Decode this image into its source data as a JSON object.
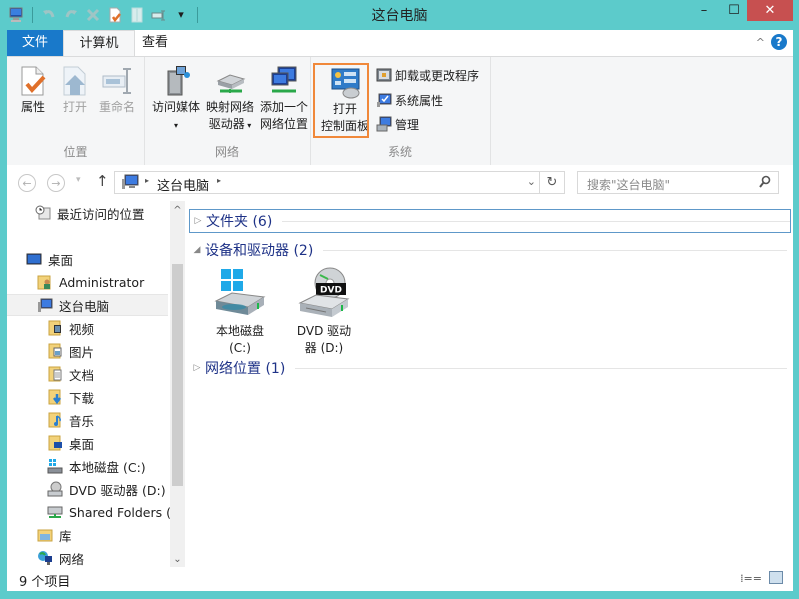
{
  "window": {
    "title": "这台电脑",
    "controls": {
      "minimize": "–",
      "maximize": "☐",
      "close": "✕"
    }
  },
  "quick_access_toolbar": {
    "icons": [
      "computer-icon",
      "undo-icon",
      "redo-icon",
      "delete-icon",
      "properties-icon",
      "new-folder-icon",
      "rename-icon",
      "customize-dropdown-icon"
    ],
    "dropdown_glyph": "▾"
  },
  "ribbon": {
    "tabs": [
      {
        "label": "文件",
        "active": false,
        "style": "file"
      },
      {
        "label": "计算机",
        "active": true
      },
      {
        "label": "查看",
        "active": false
      }
    ],
    "collapse_glyph": "^",
    "help_glyph": "?",
    "groups": [
      {
        "label": "位置",
        "buttons": [
          {
            "label": "属性",
            "enabled": true
          },
          {
            "label": "打开",
            "enabled": false
          },
          {
            "label": "重命名",
            "enabled": false
          }
        ]
      },
      {
        "label": "网络",
        "buttons": [
          {
            "label": "访问媒体",
            "dropdown": true
          },
          {
            "label": "映射网络",
            "label2": "驱动器",
            "dropdown": true
          },
          {
            "label": "添加一个",
            "label2": "网络位置"
          }
        ]
      },
      {
        "label": "系统",
        "big_button": {
          "label": "打开",
          "label2": "控制面板",
          "highlighted": true
        },
        "small_buttons": [
          {
            "label": "卸载或更改程序"
          },
          {
            "label": "系统属性"
          },
          {
            "label": "管理"
          }
        ]
      }
    ]
  },
  "navigation": {
    "back_glyph": "←",
    "forward_glyph": "→",
    "recent_glyph": "▾",
    "up_glyph": "↑",
    "breadcrumb": [
      "这台电脑"
    ],
    "separator_glyph": "▸",
    "address_dropdown_glyph": "⌄",
    "refresh_glyph": "↻",
    "search_placeholder": "搜索\"这台电脑\"",
    "search_glyph": "⚲"
  },
  "sidebar": {
    "items": [
      {
        "label": "最近访问的位置",
        "icon": "recent-places-icon",
        "level": 1
      },
      {
        "label": "桌面",
        "icon": "desktop-icon",
        "level": 0
      },
      {
        "label": "Administrator",
        "icon": "user-folder-icon",
        "level": 1
      },
      {
        "label": "这台电脑",
        "icon": "computer-icon",
        "level": 1,
        "selected": true
      },
      {
        "label": "视频",
        "icon": "videos-folder-icon",
        "level": 2
      },
      {
        "label": "图片",
        "icon": "pictures-folder-icon",
        "level": 2
      },
      {
        "label": "文档",
        "icon": "documents-folder-icon",
        "level": 2
      },
      {
        "label": "下载",
        "icon": "downloads-folder-icon",
        "level": 2
      },
      {
        "label": "音乐",
        "icon": "music-folder-icon",
        "level": 2
      },
      {
        "label": "桌面",
        "icon": "desktop-folder-icon",
        "level": 2
      },
      {
        "label": "本地磁盘 (C:)",
        "icon": "local-disk-icon",
        "level": 2
      },
      {
        "label": "DVD 驱动器 (D:)",
        "icon": "dvd-drive-icon",
        "level": 2
      },
      {
        "label": "Shared Folders (\\",
        "icon": "network-drive-icon",
        "level": 2
      },
      {
        "label": "库",
        "icon": "libraries-icon",
        "level": 1
      },
      {
        "label": "网络",
        "icon": "network-icon",
        "level": 1
      }
    ],
    "scroll_up_glyph": "^",
    "scroll_down_glyph": "⌄"
  },
  "content": {
    "groups": [
      {
        "label": "文件夹 (6)",
        "expanded": false,
        "focused": true
      },
      {
        "label": "设备和驱动器 (2)",
        "expanded": true
      },
      {
        "label": "网络位置 (1)",
        "expanded": false
      }
    ],
    "drives": [
      {
        "label_line1": "本地磁盘",
        "label_line2": "(C:)",
        "icon": "local-disk-icon"
      },
      {
        "label_line1": "DVD 驱动",
        "label_line2": "器 (D:)",
        "icon": "dvd-drive-icon",
        "badge": "DVD"
      }
    ],
    "collapsed_glyph": "▷",
    "expanded_glyph": "◢"
  },
  "status_bar": {
    "item_count": "9 个项目",
    "details_view_glyph": "⁞=="
  }
}
